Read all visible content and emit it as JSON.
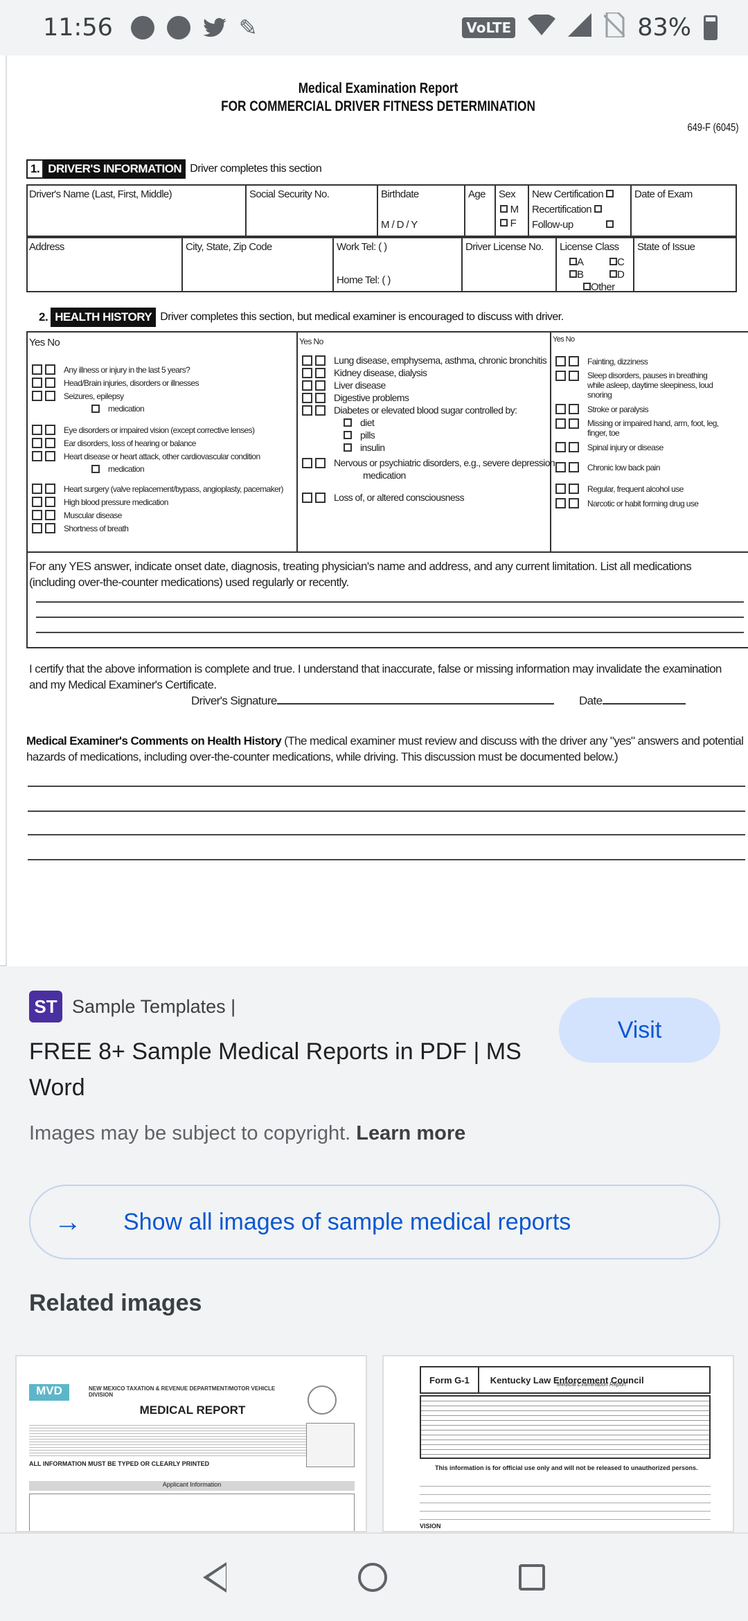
{
  "status_bar": {
    "time": "11:56",
    "network": "VoLTE",
    "battery": "83%"
  },
  "document": {
    "title": "Medical Examination Report",
    "subtitle": "FOR COMMERCIAL DRIVER FITNESS DETERMINATION",
    "form_number": "649-F (6045)",
    "section1": {
      "number": "1.",
      "label": "DRIVER'S INFORMATION",
      "note": "Driver completes this section",
      "fields": {
        "name": "Driver's Name (Last, First, Middle)",
        "ssn": "Social Security No.",
        "birthdate": "Birthdate",
        "birthdate_hint": "M / D / Y",
        "age": "Age",
        "sex": "Sex",
        "sex_m": "M",
        "sex_f": "F",
        "new_cert": "New Certification",
        "recert": "Recertification",
        "followup": "Follow-up",
        "date_exam": "Date of Exam",
        "address": "Address",
        "city": "City, State, Zip Code",
        "work_tel": "Work Tel: (  )",
        "home_tel": "Home Tel: (  )",
        "license_no": "Driver License No.",
        "license_class": "License Class",
        "class_a": "A",
        "class_b": "B",
        "class_c": "C",
        "class_d": "D",
        "class_other": "Other",
        "state_issue": "State of Issue"
      }
    },
    "section2": {
      "number": "2.",
      "label": "HEALTH HISTORY",
      "note": "Driver completes this section, but medical examiner is encouraged to discuss with driver.",
      "yes_no": "Yes No",
      "col1": [
        "Any illness or injury in the last 5 years?",
        "Head/Brain injuries, disorders or illnesses",
        "Seizures, epilepsy",
        "medication",
        "Eye disorders or impaired vision (except corrective lenses)",
        "Ear disorders, loss of hearing or balance",
        "Heart disease or heart attack, other cardiovascular condition",
        "medication",
        "Heart surgery (valve replacement/bypass, angioplasty, pacemaker)",
        "High blood pressure    medication",
        "Muscular disease",
        "Shortness of breath"
      ],
      "col2": [
        "Lung disease, emphysema, asthma, chronic bronchitis",
        "Kidney disease, dialysis",
        "Liver disease",
        "Digestive problems",
        "Diabetes or elevated blood sugar controlled by:",
        "diet",
        "pills",
        "insulin",
        "Nervous or psychiatric disorders, e.g., severe depression",
        "medication",
        "Loss of, or altered consciousness"
      ],
      "col3": [
        "Fainting, dizziness",
        "Sleep disorders, pauses in breathing while asleep, daytime sleepiness, loud snoring",
        "Stroke or paralysis",
        "Missing or impaired hand, arm, foot, leg, finger, toe",
        "Spinal injury or disease",
        "Chronic low back pain",
        "Regular, frequent alcohol use",
        "Narcotic or habit forming drug use"
      ]
    },
    "yes_answer_text": "For any YES answer, indicate onset date, diagnosis, treating physician's name and address, and any current limitation.  List all medications (including over-the-counter medications) used regularly or recently.",
    "certify_text": "I certify that the above information is complete and true.  I understand that inaccurate, false or missing information may invalidate the examination and my Medical Examiner's Certificate.",
    "driver_signature": "Driver's Signature",
    "date": "Date",
    "examiner_heading": "Medical Examiner's Comments on Health History",
    "examiner_text": "(The medical examiner must review and discuss with the driver any \"yes\" answers and potential hazards of medications, including over-the-counter medications, while driving. This discussion must be documented below.)"
  },
  "result": {
    "source_logo": "ST",
    "source_name": "Sample Templates |",
    "title": "FREE 8+ Sample Medical Reports in PDF | MS Word",
    "visit_label": "Visit",
    "copyright": "Images may be subject to copyright.",
    "learn_more": "Learn more",
    "show_all": "Show all images of sample medical reports",
    "related_heading": "Related images"
  },
  "related": [
    {
      "brand": "MVD",
      "header": "NEW MEXICO TAXATION & REVENUE DEPARTMENT/MOTOR VEHICLE DIVISION",
      "title": "MEDICAL REPORT",
      "note": "ALL INFORMATION MUST BE TYPED OR CLEARLY PRINTED",
      "section": "Applicant Information"
    },
    {
      "form": "Form G-1",
      "org": "Kentucky Law Enforcement Council",
      "subtitle": "Medical Examination Report",
      "notice": "This information is for official use only and will not be released to unauthorized persons.",
      "vision": "VISION"
    }
  ]
}
